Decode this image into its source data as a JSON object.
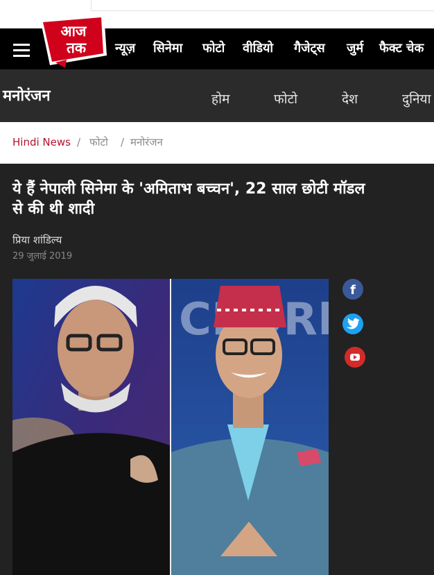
{
  "header": {
    "logo_text": "आज तक",
    "nav_items": [
      "न्यूज़",
      "सिनेमा",
      "फोटो",
      "वीडियो",
      "गैजेट्स",
      "जुर्म",
      "फैक्ट चेक"
    ]
  },
  "section": {
    "title": "मनोरंजन",
    "items": [
      "होम",
      "फोटो",
      "देश",
      "दुनिया"
    ]
  },
  "breadcrumb": {
    "home": "Hindi News",
    "separator": "/",
    "level1": "फोटो",
    "level2": "मनोरंजन"
  },
  "article": {
    "headline": "ये हैं नेपाली सिनेमा के 'अमिताभ बच्चन', 22 साल छोटी मॉडल से की थी शादी",
    "author": "प्रिया शांडिल्य",
    "date": "29 जुलाई 2019"
  },
  "share": {
    "icons": [
      "facebook-icon",
      "twitter-icon",
      "youtube-icon"
    ]
  },
  "colors": {
    "brand_red": "#d0021b",
    "nav_bg": "#000000",
    "section_bg": "#2b2b2b",
    "article_bg": "#222222",
    "breadcrumb_link": "#b5112c"
  }
}
